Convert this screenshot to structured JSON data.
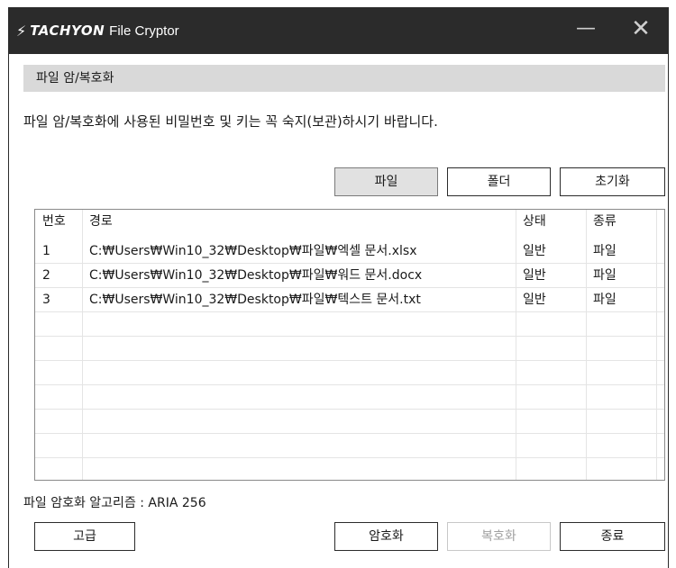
{
  "titlebar": {
    "brand": "TACHYON",
    "app_name": "File Cryptor",
    "minimize_icon": "—",
    "close_icon": "✕"
  },
  "section_title": "파일 암/복호화",
  "notice": "파일 암/복호화에 사용된 비밀번호 및 키는 꼭 숙지(보관)하시기 바랍니다.",
  "top_buttons": {
    "file": "파일",
    "folder": "폴더",
    "reset": "초기화"
  },
  "table": {
    "headers": [
      "번호",
      "경로",
      "상태",
      "종류"
    ],
    "rows": [
      [
        "1",
        "C:₩Users₩Win10_32₩Desktop₩파일₩엑셀 문서.xlsx",
        "일반",
        "파일"
      ],
      [
        "2",
        "C:₩Users₩Win10_32₩Desktop₩파일₩워드 문서.docx",
        "일반",
        "파일"
      ],
      [
        "3",
        "C:₩Users₩Win10_32₩Desktop₩파일₩텍스트 문서.txt",
        "일반",
        "파일"
      ]
    ]
  },
  "algorithm": "파일 암호화 알고리즘 : ARIA 256",
  "bottom_buttons": {
    "advanced": "고급",
    "encrypt": "암호화",
    "decrypt": "복호화",
    "exit": "종료"
  },
  "colors": {
    "titlebar": "#2b2b2b",
    "header_band": "#d9d9d9"
  }
}
